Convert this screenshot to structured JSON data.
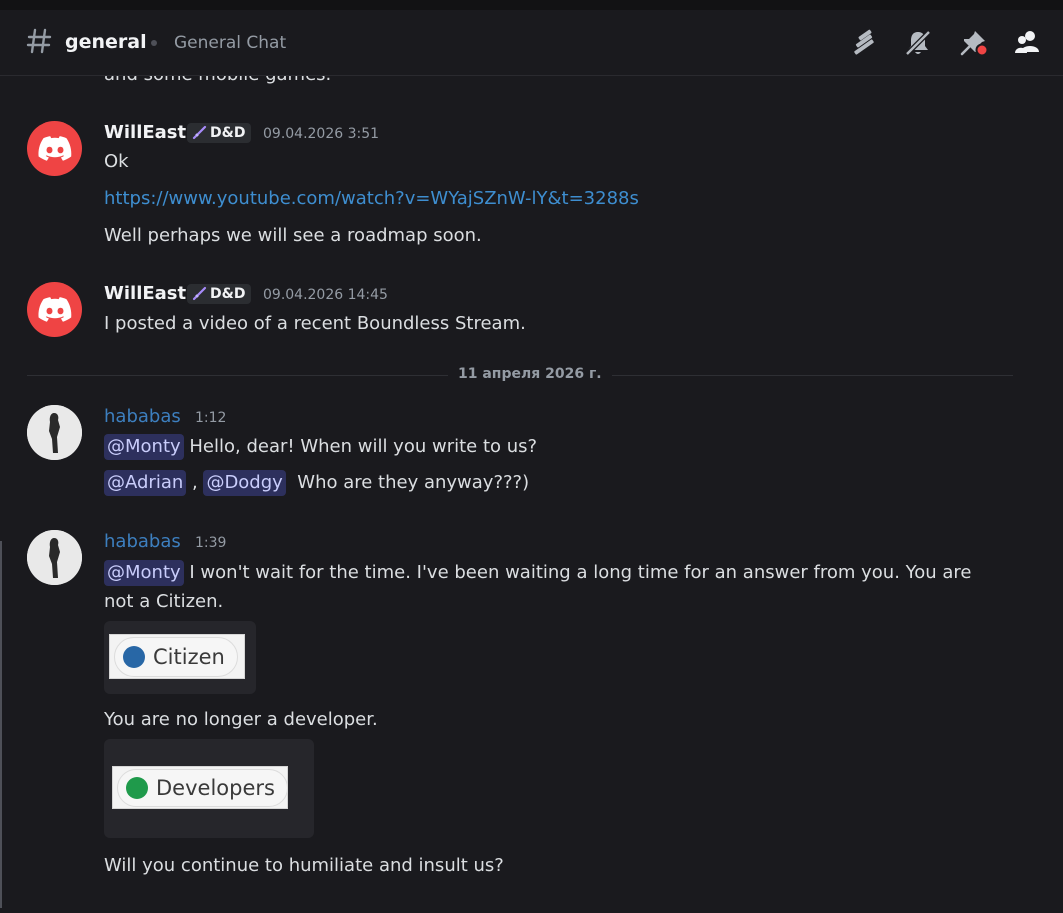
{
  "header": {
    "channel_name": "general",
    "topic": "General Chat",
    "icons": [
      "threads-icon",
      "mute-bell-icon",
      "pin-icon",
      "members-icon"
    ]
  },
  "cutoff_text": "and some mobile games.",
  "messages": [
    {
      "author": "WillEast",
      "tag": "D&D",
      "timestamp": "09.04.2026 3:51",
      "lines": [
        "Ok",
        "https://www.youtube.com/watch?v=WYajSZnW-lY&t=3288s",
        "Well perhaps we will see a roadmap soon."
      ]
    },
    {
      "author": "WillEast",
      "tag": "D&D",
      "timestamp": "09.04.2026 14:45",
      "lines": [
        "I posted a video of a recent Boundless Stream."
      ]
    },
    {
      "author": "hababas",
      "timestamp": "1:12",
      "line1_mention": "@Monty",
      "line1_text": " Hello, dear! When will you write to us?",
      "line2_mention_a": "@Adrian",
      "line2_sep": " , ",
      "line2_mention_b": "@Dodgy",
      "line2_text": "  Who are they anyway???)"
    },
    {
      "author": "hababas",
      "timestamp": "1:39",
      "line1_mention": "@Monty",
      "line1_text": " I won't wait for the time. I've been waiting a long time for an answer from you. You are",
      "line2_text": "not a Citizen.",
      "role1": {
        "name": "Citizen",
        "color": "#2867a6"
      },
      "line3_text": "You are no longer a developer.",
      "role2": {
        "name": "Developers",
        "color": "#1f9a4b"
      },
      "line4_text": "Will you continue to humiliate and insult us?"
    }
  ],
  "date_divider": "11 апреля 2026 г.",
  "colors": {
    "background": "#1a1a1e",
    "discord_avatar": "#ef4444",
    "link": "#3e8ed0",
    "hababas_name": "#3d7fbf"
  }
}
